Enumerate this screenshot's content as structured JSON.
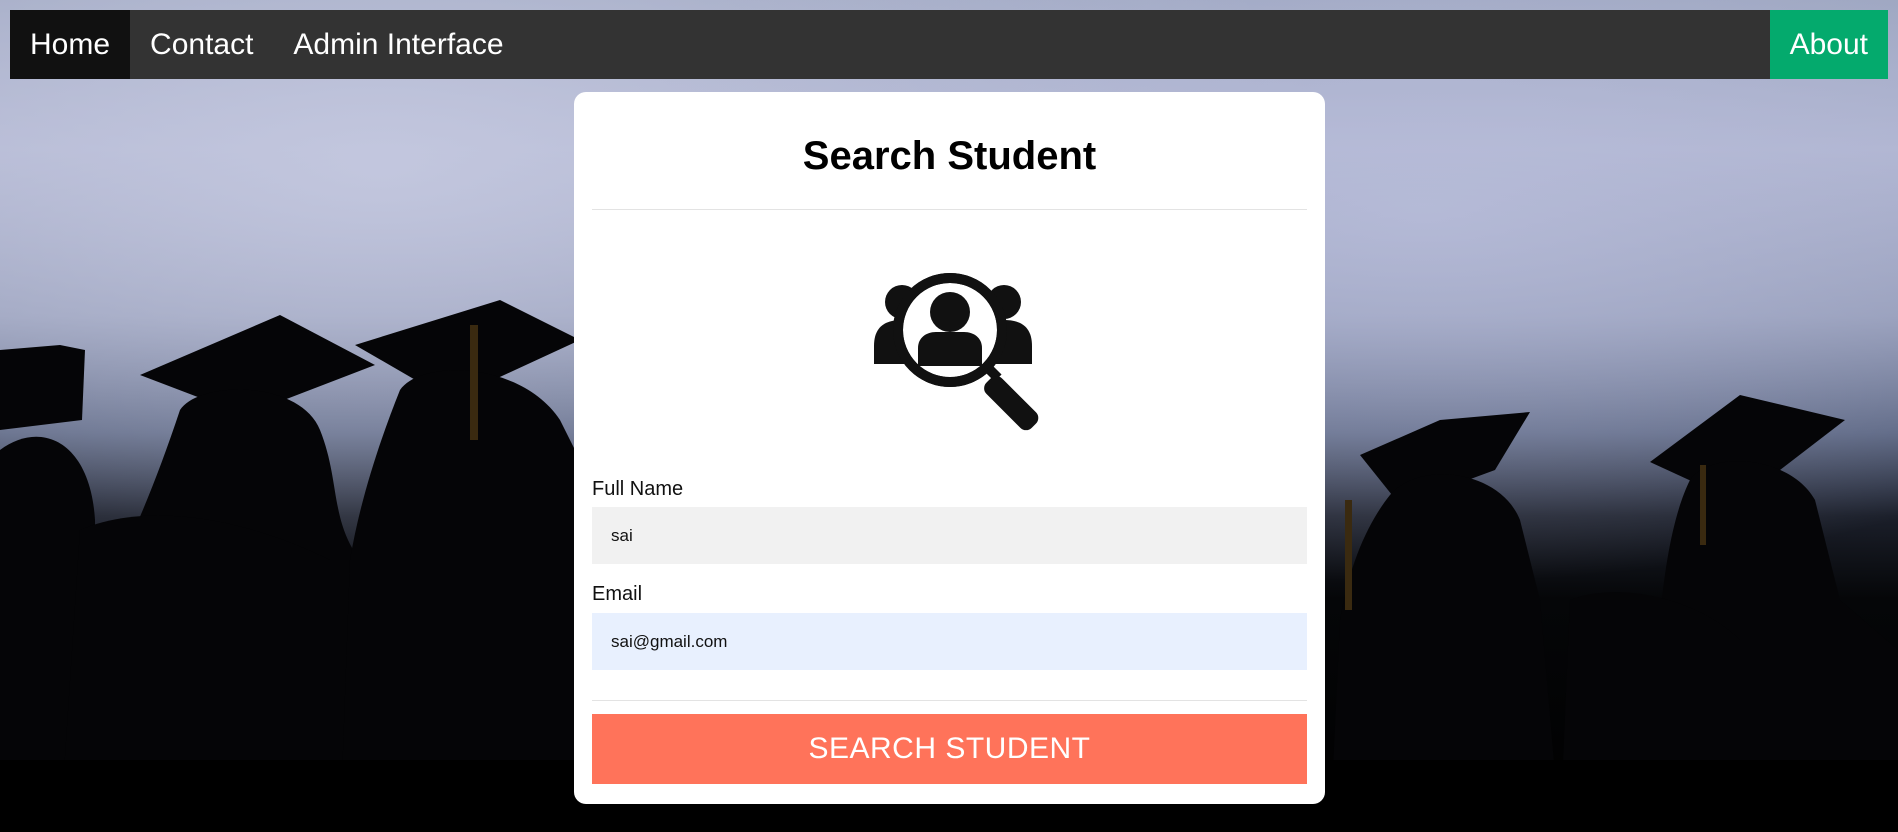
{
  "nav": {
    "home": "Home",
    "contact": "Contact",
    "admin": "Admin Interface",
    "about": "About"
  },
  "form": {
    "title": "Search Student",
    "full_name_label": "Full Name",
    "full_name_value": "sai",
    "email_label": "Email",
    "email_value": "sai@gmail.com",
    "submit_label": "SEARCH STUDENT"
  },
  "icons": {
    "search_graphic": "search-student-icon"
  },
  "colors": {
    "navbar_bg": "#333333",
    "nav_active_bg": "#111111",
    "about_bg": "#04aa6d",
    "submit_bg": "#ff735a",
    "name_field_bg": "#f1f1f1",
    "email_field_bg": "#e8f0fe"
  }
}
